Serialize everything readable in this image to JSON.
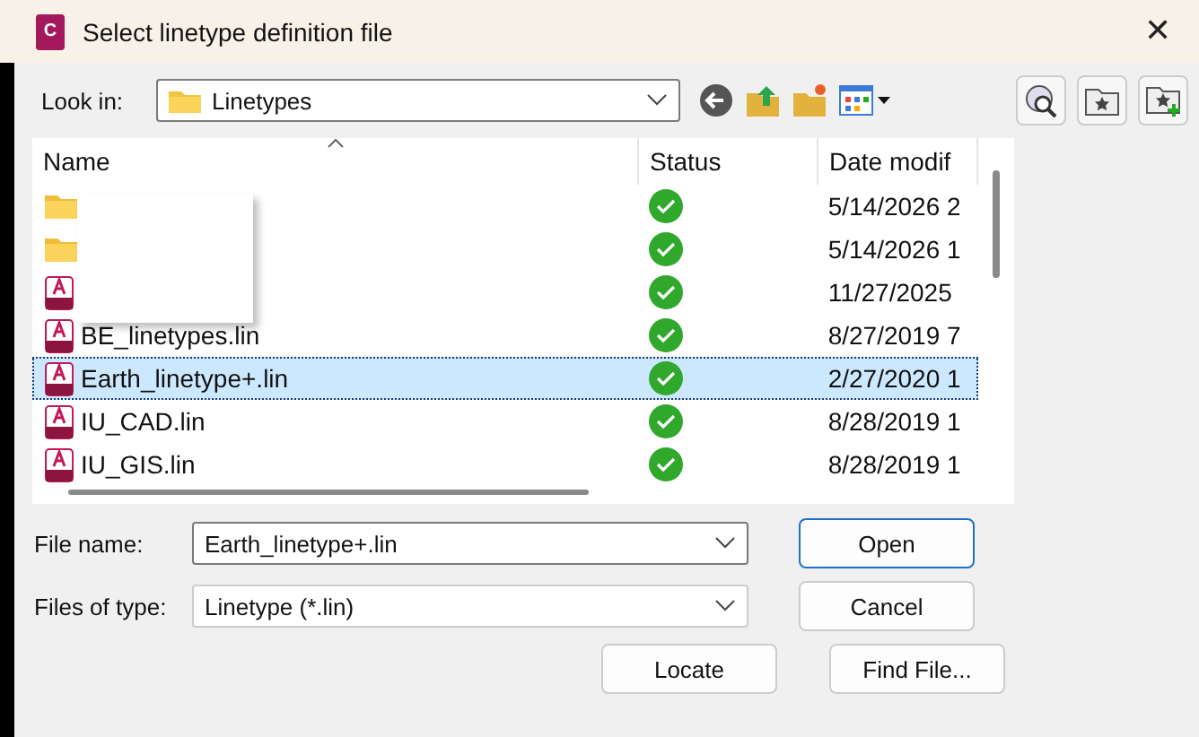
{
  "window": {
    "title": "Select linetype definition file",
    "close": "✕",
    "app_icon_letter": "C"
  },
  "look_in": {
    "label": "Look in:",
    "value": "Linetypes"
  },
  "columns": [
    {
      "label": "Name",
      "sorted": true
    },
    {
      "label": "Status",
      "sorted": false
    },
    {
      "label": "Date modif",
      "sorted": false
    }
  ],
  "rows": [
    {
      "kind": "folder",
      "date": "5/14/2026 2",
      "selected": false
    },
    {
      "kind": "folder",
      "date": "5/14/2026 1",
      "selected": false
    },
    {
      "kind": "lin",
      "date": "11/27/2025",
      "selected": false
    },
    {
      "kind": "lin",
      "name": "BE_linetypes.lin",
      "date": "8/27/2019 7",
      "selected": false
    },
    {
      "kind": "lin",
      "name": "Earth_linetype+.lin",
      "date": "2/27/2020 1",
      "selected": true
    },
    {
      "kind": "lin",
      "name": "IU_CAD.lin",
      "date": "8/28/2019 1",
      "selected": false
    },
    {
      "kind": "lin",
      "name": "IU_GIS.lin",
      "date": "8/28/2019 1",
      "selected": false
    }
  ],
  "file_name": {
    "label": "File name:",
    "value": "Earth_linetype+.lin"
  },
  "file_type": {
    "label": "Files of type:",
    "value": "Linetype (*.lin)"
  },
  "buttons": [
    {
      "label": "Open",
      "default": true
    },
    {
      "label": "Cancel",
      "default": false
    },
    {
      "label": "Locate",
      "default": false
    },
    {
      "label": "Find File...",
      "default": false
    }
  ]
}
